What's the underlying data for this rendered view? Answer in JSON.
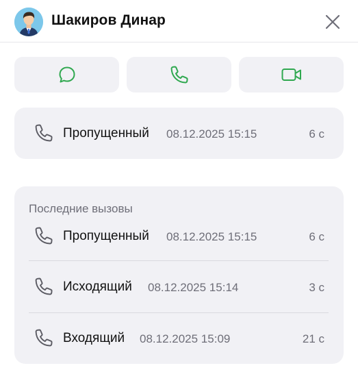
{
  "contact": {
    "name": "Шакиров Динар",
    "avatar_icon": "user-avatar-icon"
  },
  "actions": [
    {
      "name": "message",
      "icon": "chat-bubble-icon"
    },
    {
      "name": "call",
      "icon": "phone-icon"
    },
    {
      "name": "video",
      "icon": "video-camera-icon"
    }
  ],
  "current_call": {
    "type": "Пропущенный",
    "datetime": "08.12.2025 15:15",
    "duration": "6 с"
  },
  "recent": {
    "label": "Последние вызовы",
    "items": [
      {
        "type": "Пропущенный",
        "datetime": "08.12.2025 15:15",
        "duration": "6 с"
      },
      {
        "type": "Исходящий",
        "datetime": "08.12.2025 15:14",
        "duration": "3 с"
      },
      {
        "type": "Входящий",
        "datetime": "08.12.2025 15:09",
        "duration": "21 с"
      }
    ]
  },
  "colors": {
    "accent": "#2fa84f",
    "card_background": "#f1f1f5",
    "secondary_text": "#6e6e78",
    "icon_gray": "#5b5b63"
  }
}
